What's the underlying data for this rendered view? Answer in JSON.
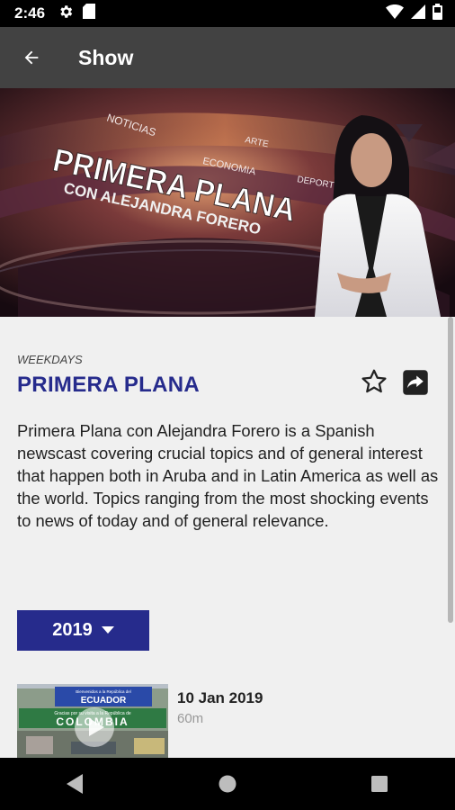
{
  "status_bar": {
    "time": "2:46",
    "icons_left": [
      "settings-icon",
      "sd-card-icon"
    ],
    "icons_right": [
      "wifi-icon",
      "cell-signal-icon",
      "battery-icon"
    ]
  },
  "app_bar": {
    "title": "Show",
    "back_icon": "arrow-back-icon"
  },
  "banner": {
    "logo_line1": "PRIMERA PLANA",
    "logo_line2": "CON ALEJANDRA FORERO",
    "ribbon_words": [
      "NOTICIAS",
      "ECONOMIA",
      "ARTE",
      "DEPORTES"
    ]
  },
  "show": {
    "schedule": "WEEKDAYS",
    "title": "PRIMERA PLANA",
    "description": "Primera Plana con Alejandra Forero is a Spanish newscast covering crucial topics and of general interest that happen both in Aruba and in Latin America as well as the world. Topics ranging from the most shocking events to news of today and of general relevance."
  },
  "year_selector": {
    "selected": "2019",
    "icon": "caret-down-icon"
  },
  "episodes": [
    {
      "date": "10 Jan 2019",
      "duration": "60m",
      "thumb_sign_top": "Bienvenidos a la República del",
      "thumb_sign_country": "ECUADOR",
      "thumb_sign2_top": "Gracias por su visita a la República de",
      "thumb_sign2_country": "COLOMBIA"
    }
  ],
  "nav_bar": {
    "icons": [
      "nav-back-icon",
      "nav-home-icon",
      "nav-recents-icon"
    ]
  },
  "colors": {
    "accent": "#262b8c",
    "app_bar": "#424242",
    "background": "#f0f0f0"
  }
}
